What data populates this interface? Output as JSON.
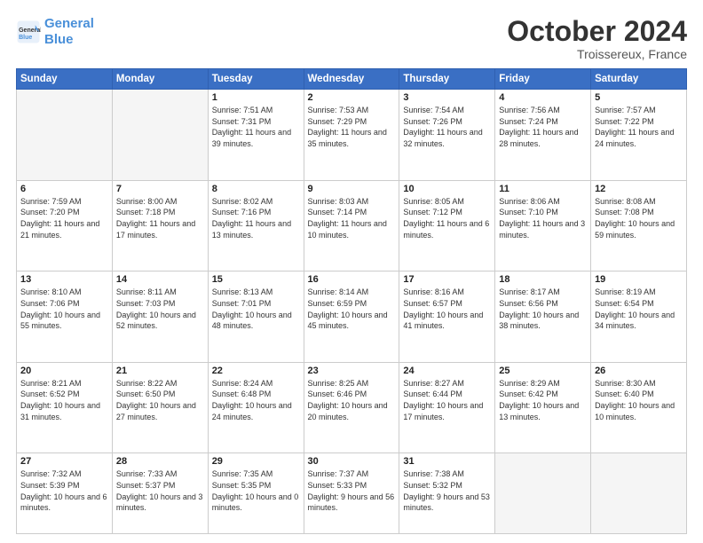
{
  "header": {
    "logo_line1": "General",
    "logo_line2": "Blue",
    "month": "October 2024",
    "location": "Troissereux, France"
  },
  "weekdays": [
    "Sunday",
    "Monday",
    "Tuesday",
    "Wednesday",
    "Thursday",
    "Friday",
    "Saturday"
  ],
  "weeks": [
    [
      {
        "day": "",
        "info": ""
      },
      {
        "day": "",
        "info": ""
      },
      {
        "day": "1",
        "info": "Sunrise: 7:51 AM\nSunset: 7:31 PM\nDaylight: 11 hours and 39 minutes."
      },
      {
        "day": "2",
        "info": "Sunrise: 7:53 AM\nSunset: 7:29 PM\nDaylight: 11 hours and 35 minutes."
      },
      {
        "day": "3",
        "info": "Sunrise: 7:54 AM\nSunset: 7:26 PM\nDaylight: 11 hours and 32 minutes."
      },
      {
        "day": "4",
        "info": "Sunrise: 7:56 AM\nSunset: 7:24 PM\nDaylight: 11 hours and 28 minutes."
      },
      {
        "day": "5",
        "info": "Sunrise: 7:57 AM\nSunset: 7:22 PM\nDaylight: 11 hours and 24 minutes."
      }
    ],
    [
      {
        "day": "6",
        "info": "Sunrise: 7:59 AM\nSunset: 7:20 PM\nDaylight: 11 hours and 21 minutes."
      },
      {
        "day": "7",
        "info": "Sunrise: 8:00 AM\nSunset: 7:18 PM\nDaylight: 11 hours and 17 minutes."
      },
      {
        "day": "8",
        "info": "Sunrise: 8:02 AM\nSunset: 7:16 PM\nDaylight: 11 hours and 13 minutes."
      },
      {
        "day": "9",
        "info": "Sunrise: 8:03 AM\nSunset: 7:14 PM\nDaylight: 11 hours and 10 minutes."
      },
      {
        "day": "10",
        "info": "Sunrise: 8:05 AM\nSunset: 7:12 PM\nDaylight: 11 hours and 6 minutes."
      },
      {
        "day": "11",
        "info": "Sunrise: 8:06 AM\nSunset: 7:10 PM\nDaylight: 11 hours and 3 minutes."
      },
      {
        "day": "12",
        "info": "Sunrise: 8:08 AM\nSunset: 7:08 PM\nDaylight: 10 hours and 59 minutes."
      }
    ],
    [
      {
        "day": "13",
        "info": "Sunrise: 8:10 AM\nSunset: 7:06 PM\nDaylight: 10 hours and 55 minutes."
      },
      {
        "day": "14",
        "info": "Sunrise: 8:11 AM\nSunset: 7:03 PM\nDaylight: 10 hours and 52 minutes."
      },
      {
        "day": "15",
        "info": "Sunrise: 8:13 AM\nSunset: 7:01 PM\nDaylight: 10 hours and 48 minutes."
      },
      {
        "day": "16",
        "info": "Sunrise: 8:14 AM\nSunset: 6:59 PM\nDaylight: 10 hours and 45 minutes."
      },
      {
        "day": "17",
        "info": "Sunrise: 8:16 AM\nSunset: 6:57 PM\nDaylight: 10 hours and 41 minutes."
      },
      {
        "day": "18",
        "info": "Sunrise: 8:17 AM\nSunset: 6:56 PM\nDaylight: 10 hours and 38 minutes."
      },
      {
        "day": "19",
        "info": "Sunrise: 8:19 AM\nSunset: 6:54 PM\nDaylight: 10 hours and 34 minutes."
      }
    ],
    [
      {
        "day": "20",
        "info": "Sunrise: 8:21 AM\nSunset: 6:52 PM\nDaylight: 10 hours and 31 minutes."
      },
      {
        "day": "21",
        "info": "Sunrise: 8:22 AM\nSunset: 6:50 PM\nDaylight: 10 hours and 27 minutes."
      },
      {
        "day": "22",
        "info": "Sunrise: 8:24 AM\nSunset: 6:48 PM\nDaylight: 10 hours and 24 minutes."
      },
      {
        "day": "23",
        "info": "Sunrise: 8:25 AM\nSunset: 6:46 PM\nDaylight: 10 hours and 20 minutes."
      },
      {
        "day": "24",
        "info": "Sunrise: 8:27 AM\nSunset: 6:44 PM\nDaylight: 10 hours and 17 minutes."
      },
      {
        "day": "25",
        "info": "Sunrise: 8:29 AM\nSunset: 6:42 PM\nDaylight: 10 hours and 13 minutes."
      },
      {
        "day": "26",
        "info": "Sunrise: 8:30 AM\nSunset: 6:40 PM\nDaylight: 10 hours and 10 minutes."
      }
    ],
    [
      {
        "day": "27",
        "info": "Sunrise: 7:32 AM\nSunset: 5:39 PM\nDaylight: 10 hours and 6 minutes."
      },
      {
        "day": "28",
        "info": "Sunrise: 7:33 AM\nSunset: 5:37 PM\nDaylight: 10 hours and 3 minutes."
      },
      {
        "day": "29",
        "info": "Sunrise: 7:35 AM\nSunset: 5:35 PM\nDaylight: 10 hours and 0 minutes."
      },
      {
        "day": "30",
        "info": "Sunrise: 7:37 AM\nSunset: 5:33 PM\nDaylight: 9 hours and 56 minutes."
      },
      {
        "day": "31",
        "info": "Sunrise: 7:38 AM\nSunset: 5:32 PM\nDaylight: 9 hours and 53 minutes."
      },
      {
        "day": "",
        "info": ""
      },
      {
        "day": "",
        "info": ""
      }
    ]
  ]
}
